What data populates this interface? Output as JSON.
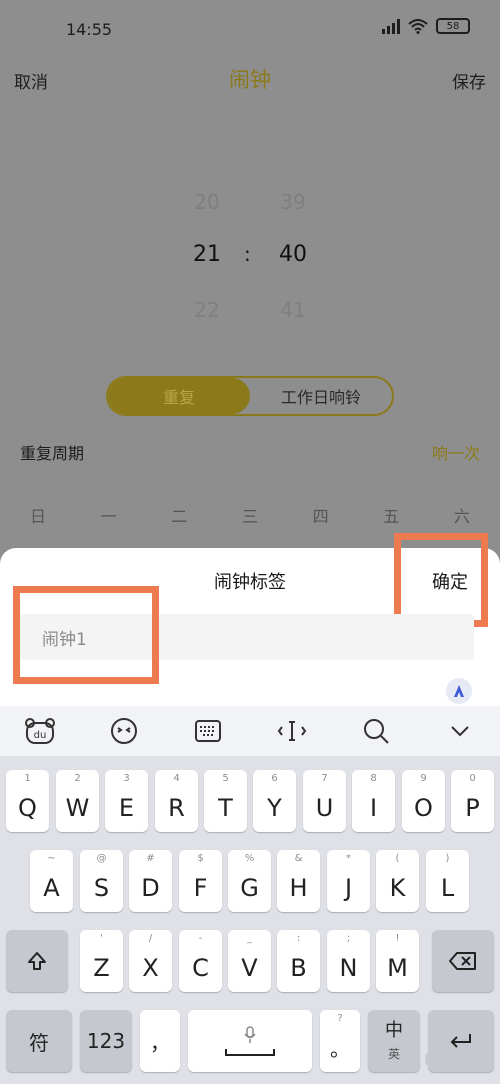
{
  "status": {
    "time": "14:55",
    "battery": "58"
  },
  "nav": {
    "cancel": "取消",
    "title": "闹钟",
    "save": "保存"
  },
  "picker": {
    "hours": [
      "20",
      "21",
      "22"
    ],
    "minutes": [
      "39",
      "40",
      "41"
    ],
    "separator": ":"
  },
  "segment": {
    "repeat": "重复",
    "workday": "工作日响铃"
  },
  "repeat_cycle": {
    "label": "重复周期",
    "value": "响一次"
  },
  "weekdays": [
    "日",
    "一",
    "二",
    "三",
    "四",
    "五",
    "六"
  ],
  "sheet": {
    "title": "闹钟标签",
    "confirm": "确定",
    "input_value": "闹钟1"
  },
  "keyboard": {
    "toolbar": [
      "baidu-bear-icon",
      "emoji-icon",
      "keyboard-icon",
      "cursor-icon",
      "search-icon",
      "collapse-icon"
    ],
    "row1": [
      {
        "k": "Q",
        "h": "1"
      },
      {
        "k": "W",
        "h": "2"
      },
      {
        "k": "E",
        "h": "3"
      },
      {
        "k": "R",
        "h": "4"
      },
      {
        "k": "T",
        "h": "5"
      },
      {
        "k": "Y",
        "h": "6"
      },
      {
        "k": "U",
        "h": "7"
      },
      {
        "k": "I",
        "h": "8"
      },
      {
        "k": "O",
        "h": "9"
      },
      {
        "k": "P",
        "h": "0"
      }
    ],
    "row2": [
      {
        "k": "A",
        "h": "~"
      },
      {
        "k": "S",
        "h": "@"
      },
      {
        "k": "D",
        "h": "#"
      },
      {
        "k": "F",
        "h": "$"
      },
      {
        "k": "G",
        "h": "%"
      },
      {
        "k": "H",
        "h": "&"
      },
      {
        "k": "J",
        "h": "*"
      },
      {
        "k": "K",
        "h": "("
      },
      {
        "k": "L",
        "h": ")"
      }
    ],
    "row3": [
      {
        "k": "Z",
        "h": "'"
      },
      {
        "k": "X",
        "h": "/"
      },
      {
        "k": "C",
        "h": "-"
      },
      {
        "k": "V",
        "h": "_"
      },
      {
        "k": "B",
        "h": ":"
      },
      {
        "k": "N",
        "h": ";"
      },
      {
        "k": "M",
        "h": "!"
      }
    ],
    "symbols": "符",
    "numbers": "123",
    "comma": "，",
    "question": "?",
    "period": "。",
    "lang": "中",
    "lang_sub": "英"
  },
  "watermark": "Bai 经验"
}
